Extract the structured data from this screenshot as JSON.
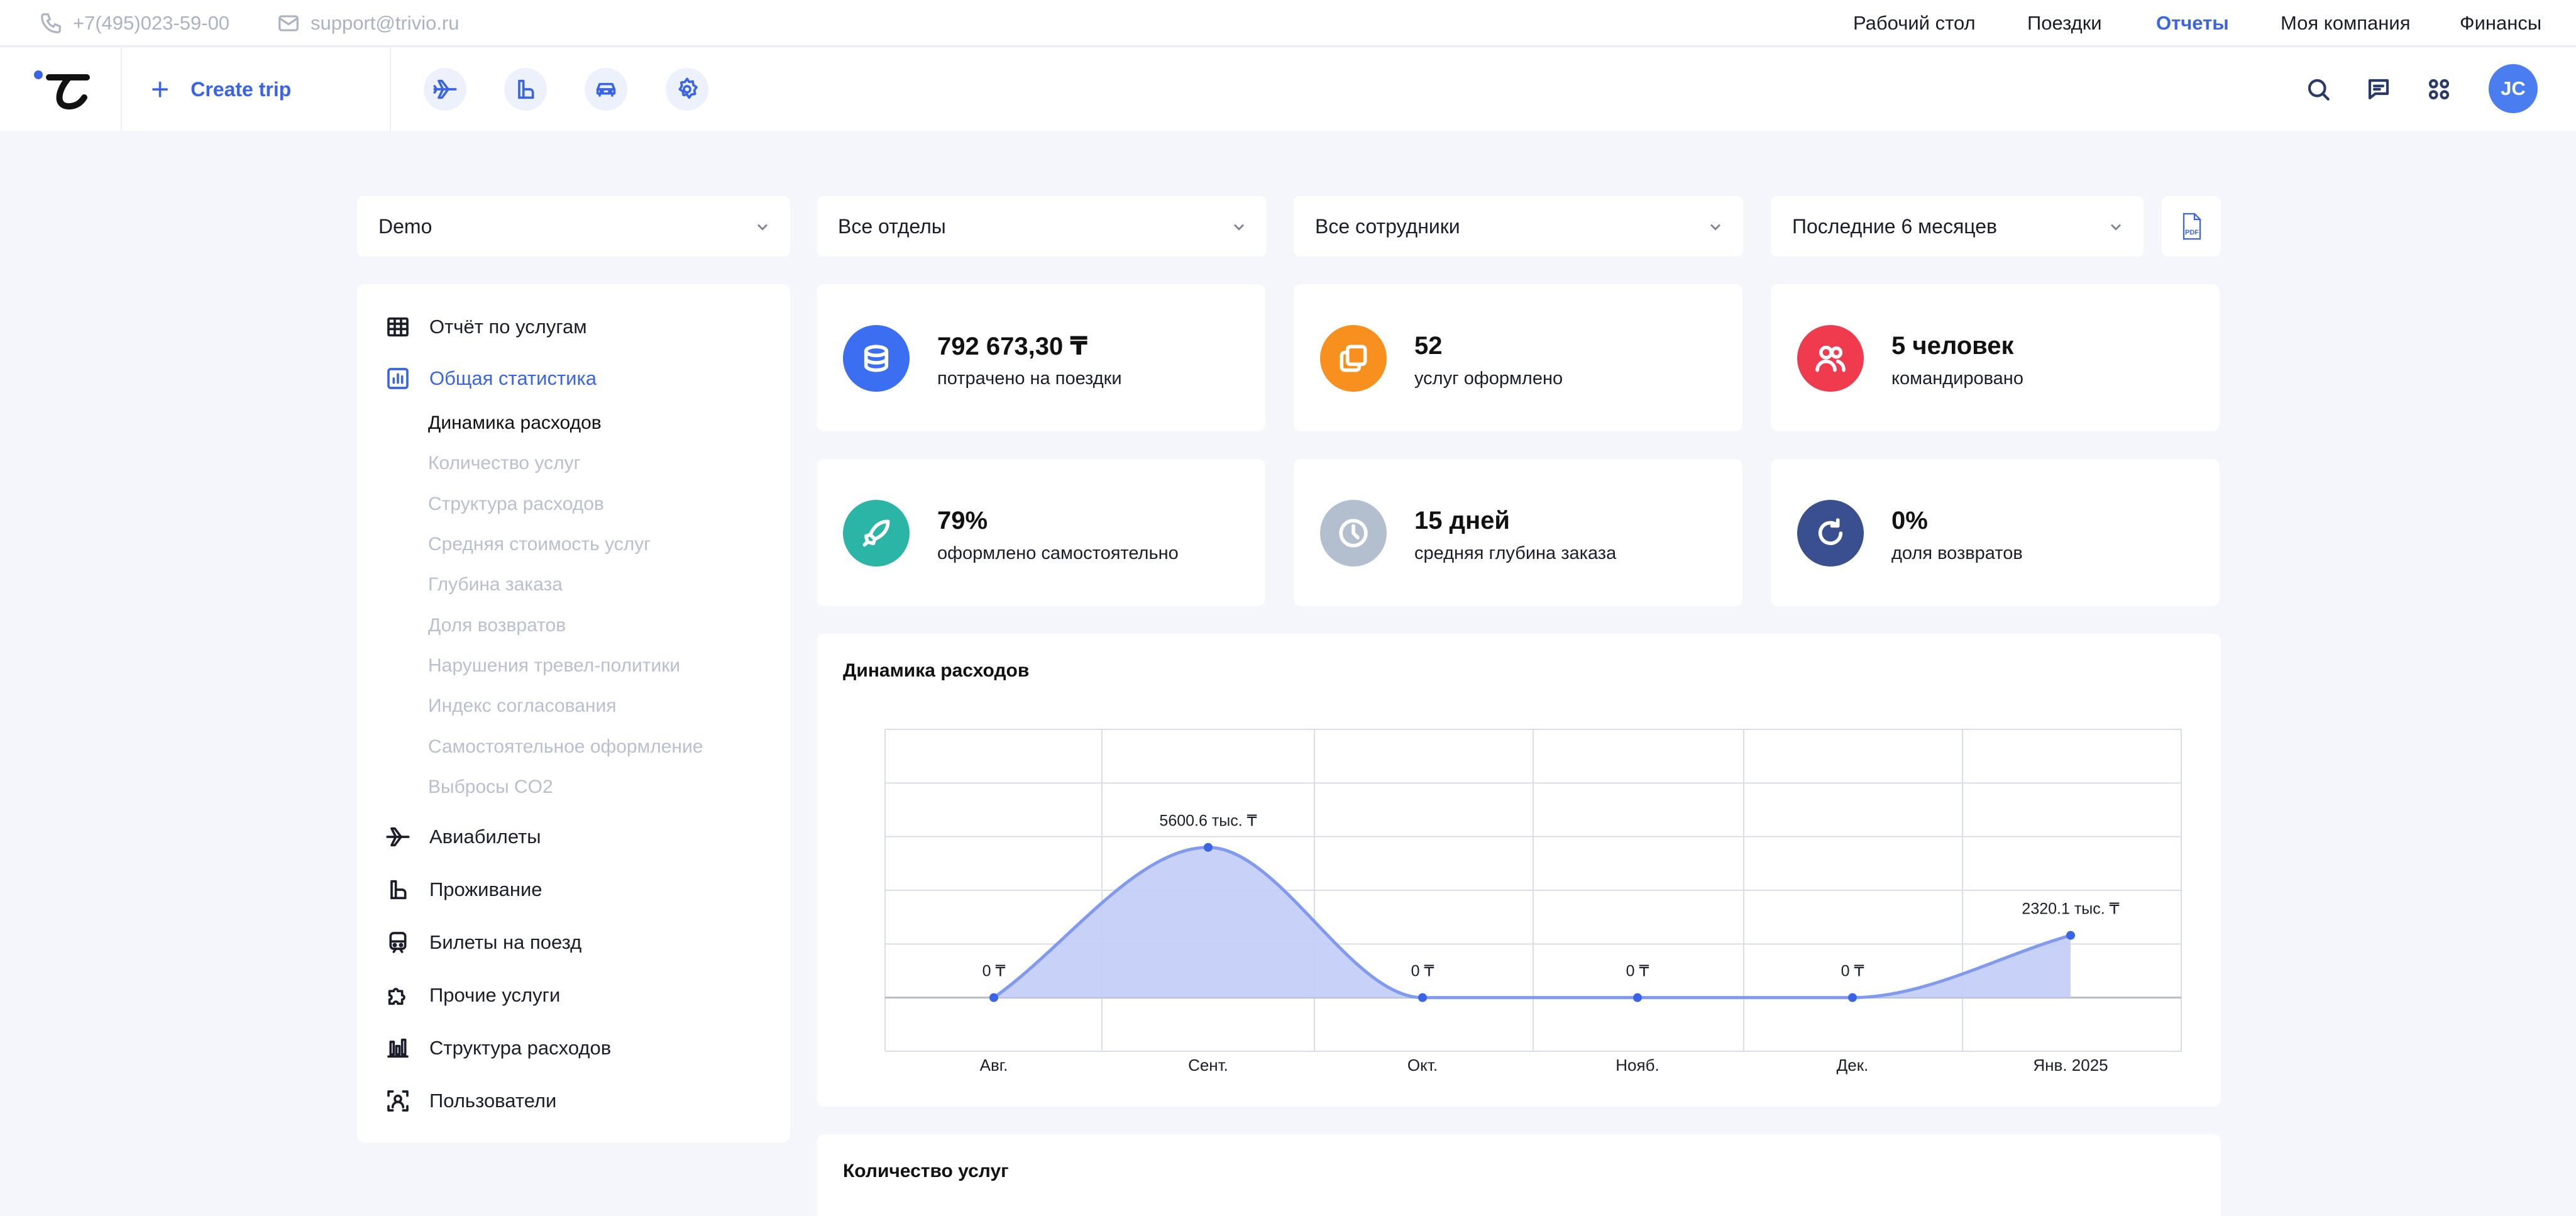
{
  "topbar": {
    "phone": "+7(495)023-59-00",
    "email": "support@trivio.ru",
    "nav": [
      {
        "label": "Рабочий стол",
        "active": false
      },
      {
        "label": "Поездки",
        "active": false
      },
      {
        "label": "Отчеты",
        "active": true
      },
      {
        "label": "Моя компания",
        "active": false
      },
      {
        "label": "Финансы",
        "active": false
      }
    ]
  },
  "header": {
    "create_label": "Create trip",
    "quick_icons": [
      "plane-icon",
      "hotel-icon",
      "car-icon",
      "settings-icon"
    ],
    "right_icons": [
      "search-icon",
      "chat-icon",
      "apps-icon"
    ],
    "avatar_initials": "JC"
  },
  "filters": {
    "company": "Demo",
    "department": "Все отделы",
    "employees": "Все сотрудники",
    "period": "Последние 6 месяцев",
    "pdf_label": "PDF"
  },
  "sidebar": {
    "items": [
      {
        "label": "Отчёт по услугам",
        "icon": "table-icon"
      },
      {
        "label": "Общая статистика",
        "icon": "stats-icon",
        "active": true
      },
      {
        "label": "Авиабилеты",
        "icon": "plane-icon"
      },
      {
        "label": "Проживание",
        "icon": "hotel-icon"
      },
      {
        "label": "Билеты на поезд",
        "icon": "train-icon"
      },
      {
        "label": "Прочие услуги",
        "icon": "puzzle-icon"
      },
      {
        "label": "Структура расходов",
        "icon": "bars-icon"
      },
      {
        "label": "Пользователи",
        "icon": "users-scan-icon"
      }
    ],
    "subitems": [
      "Динамика расходов",
      "Количество услуг",
      "Структура расходов",
      "Средняя стоимость услуг",
      "Глубина заказа",
      "Доля возвратов",
      "Нарушения тревел-политики",
      "Индекс согласования",
      "Самостоятельное оформление",
      "Выбросы CO2"
    ]
  },
  "stats": [
    {
      "value": "792 673,30 ₸",
      "label": "потрачено на поездки",
      "color": "#3b6ef0",
      "icon": "coins-icon"
    },
    {
      "value": "52",
      "label": "услуг оформлено",
      "color": "#f7901e",
      "icon": "copy-icon"
    },
    {
      "value": "5 человек",
      "label": "командировано",
      "color": "#f03a4e",
      "icon": "people-icon"
    },
    {
      "value": "79%",
      "label": "оформлено самостоятельно",
      "color": "#2bb5a6",
      "icon": "rocket-icon"
    },
    {
      "value": "15 дней",
      "label": "средняя глубина заказа",
      "color": "#b3bfcf",
      "icon": "clock-icon"
    },
    {
      "value": "0%",
      "label": "доля возвратов",
      "color": "#3a4f8f",
      "icon": "refresh-icon"
    }
  ],
  "chart_panel": {
    "title": "Динамика расходов"
  },
  "next_panel": {
    "title": "Количество услуг"
  },
  "chart_data": {
    "type": "area",
    "title": "Динамика расходов",
    "categories": [
      "Авг.",
      "Сент.",
      "Окт.",
      "Нояб.",
      "Дек.",
      "Янв. 2025"
    ],
    "values": [
      0,
      5600.6,
      0,
      0,
      0,
      2320.1
    ],
    "data_labels": [
      "0 ₸",
      "5600.6 тыс. ₸",
      "0 ₸",
      "0 ₸",
      "0 ₸",
      "2320.1 тыс. ₸"
    ],
    "ylim": [
      -2000,
      10000
    ],
    "grid": true,
    "color": "#3a64e6",
    "fill": "#c2ccf7"
  }
}
